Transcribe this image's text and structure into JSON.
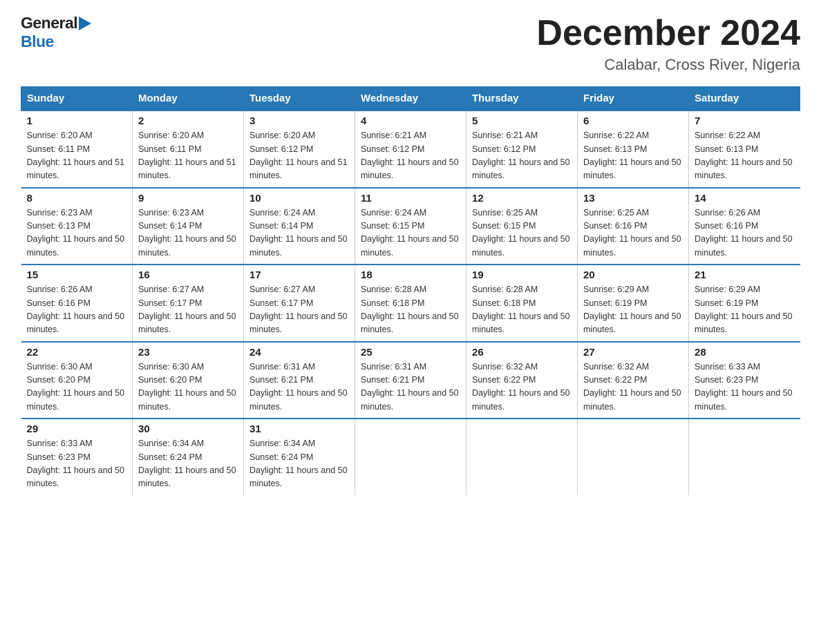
{
  "header": {
    "title": "December 2024",
    "subtitle": "Calabar, Cross River, Nigeria",
    "logo_general": "General",
    "logo_blue": "Blue"
  },
  "columns": [
    "Sunday",
    "Monday",
    "Tuesday",
    "Wednesday",
    "Thursday",
    "Friday",
    "Saturday"
  ],
  "weeks": [
    [
      {
        "day": "1",
        "sunrise": "6:20 AM",
        "sunset": "6:11 PM",
        "daylight": "11 hours and 51 minutes."
      },
      {
        "day": "2",
        "sunrise": "6:20 AM",
        "sunset": "6:11 PM",
        "daylight": "11 hours and 51 minutes."
      },
      {
        "day": "3",
        "sunrise": "6:20 AM",
        "sunset": "6:12 PM",
        "daylight": "11 hours and 51 minutes."
      },
      {
        "day": "4",
        "sunrise": "6:21 AM",
        "sunset": "6:12 PM",
        "daylight": "11 hours and 50 minutes."
      },
      {
        "day": "5",
        "sunrise": "6:21 AM",
        "sunset": "6:12 PM",
        "daylight": "11 hours and 50 minutes."
      },
      {
        "day": "6",
        "sunrise": "6:22 AM",
        "sunset": "6:13 PM",
        "daylight": "11 hours and 50 minutes."
      },
      {
        "day": "7",
        "sunrise": "6:22 AM",
        "sunset": "6:13 PM",
        "daylight": "11 hours and 50 minutes."
      }
    ],
    [
      {
        "day": "8",
        "sunrise": "6:23 AM",
        "sunset": "6:13 PM",
        "daylight": "11 hours and 50 minutes."
      },
      {
        "day": "9",
        "sunrise": "6:23 AM",
        "sunset": "6:14 PM",
        "daylight": "11 hours and 50 minutes."
      },
      {
        "day": "10",
        "sunrise": "6:24 AM",
        "sunset": "6:14 PM",
        "daylight": "11 hours and 50 minutes."
      },
      {
        "day": "11",
        "sunrise": "6:24 AM",
        "sunset": "6:15 PM",
        "daylight": "11 hours and 50 minutes."
      },
      {
        "day": "12",
        "sunrise": "6:25 AM",
        "sunset": "6:15 PM",
        "daylight": "11 hours and 50 minutes."
      },
      {
        "day": "13",
        "sunrise": "6:25 AM",
        "sunset": "6:16 PM",
        "daylight": "11 hours and 50 minutes."
      },
      {
        "day": "14",
        "sunrise": "6:26 AM",
        "sunset": "6:16 PM",
        "daylight": "11 hours and 50 minutes."
      }
    ],
    [
      {
        "day": "15",
        "sunrise": "6:26 AM",
        "sunset": "6:16 PM",
        "daylight": "11 hours and 50 minutes."
      },
      {
        "day": "16",
        "sunrise": "6:27 AM",
        "sunset": "6:17 PM",
        "daylight": "11 hours and 50 minutes."
      },
      {
        "day": "17",
        "sunrise": "6:27 AM",
        "sunset": "6:17 PM",
        "daylight": "11 hours and 50 minutes."
      },
      {
        "day": "18",
        "sunrise": "6:28 AM",
        "sunset": "6:18 PM",
        "daylight": "11 hours and 50 minutes."
      },
      {
        "day": "19",
        "sunrise": "6:28 AM",
        "sunset": "6:18 PM",
        "daylight": "11 hours and 50 minutes."
      },
      {
        "day": "20",
        "sunrise": "6:29 AM",
        "sunset": "6:19 PM",
        "daylight": "11 hours and 50 minutes."
      },
      {
        "day": "21",
        "sunrise": "6:29 AM",
        "sunset": "6:19 PM",
        "daylight": "11 hours and 50 minutes."
      }
    ],
    [
      {
        "day": "22",
        "sunrise": "6:30 AM",
        "sunset": "6:20 PM",
        "daylight": "11 hours and 50 minutes."
      },
      {
        "day": "23",
        "sunrise": "6:30 AM",
        "sunset": "6:20 PM",
        "daylight": "11 hours and 50 minutes."
      },
      {
        "day": "24",
        "sunrise": "6:31 AM",
        "sunset": "6:21 PM",
        "daylight": "11 hours and 50 minutes."
      },
      {
        "day": "25",
        "sunrise": "6:31 AM",
        "sunset": "6:21 PM",
        "daylight": "11 hours and 50 minutes."
      },
      {
        "day": "26",
        "sunrise": "6:32 AM",
        "sunset": "6:22 PM",
        "daylight": "11 hours and 50 minutes."
      },
      {
        "day": "27",
        "sunrise": "6:32 AM",
        "sunset": "6:22 PM",
        "daylight": "11 hours and 50 minutes."
      },
      {
        "day": "28",
        "sunrise": "6:33 AM",
        "sunset": "6:23 PM",
        "daylight": "11 hours and 50 minutes."
      }
    ],
    [
      {
        "day": "29",
        "sunrise": "6:33 AM",
        "sunset": "6:23 PM",
        "daylight": "11 hours and 50 minutes."
      },
      {
        "day": "30",
        "sunrise": "6:34 AM",
        "sunset": "6:24 PM",
        "daylight": "11 hours and 50 minutes."
      },
      {
        "day": "31",
        "sunrise": "6:34 AM",
        "sunset": "6:24 PM",
        "daylight": "11 hours and 50 minutes."
      },
      null,
      null,
      null,
      null
    ]
  ],
  "labels": {
    "sunrise_prefix": "Sunrise: ",
    "sunset_prefix": "Sunset: ",
    "daylight_prefix": "Daylight: "
  }
}
